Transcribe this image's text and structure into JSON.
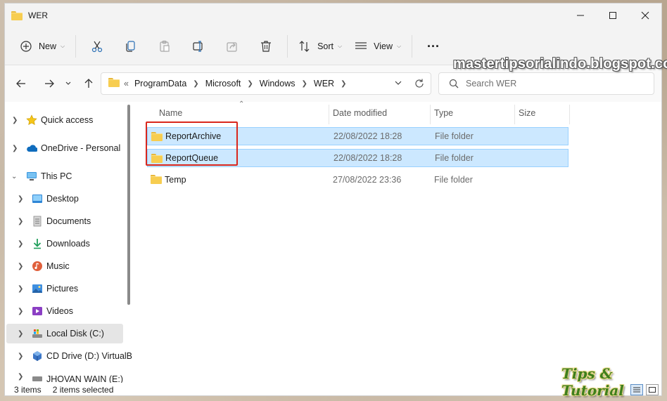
{
  "window": {
    "title": "WER"
  },
  "toolbar": {
    "new_label": "New",
    "sort_label": "Sort",
    "view_label": "View",
    "more_label": "..."
  },
  "address": {
    "overflow": "«",
    "crumbs": [
      "ProgramData",
      "Microsoft",
      "Windows",
      "WER"
    ]
  },
  "search": {
    "placeholder": "Search WER"
  },
  "nav": {
    "items": [
      {
        "label": "Quick access",
        "icon": "star-icon"
      },
      {
        "label": "OneDrive - Personal",
        "icon": "cloud-icon"
      },
      {
        "label": "This PC",
        "icon": "computer-icon"
      },
      {
        "label": "Desktop",
        "icon": "desktop-icon"
      },
      {
        "label": "Documents",
        "icon": "document-icon"
      },
      {
        "label": "Downloads",
        "icon": "download-icon"
      },
      {
        "label": "Music",
        "icon": "music-icon"
      },
      {
        "label": "Pictures",
        "icon": "pictures-icon"
      },
      {
        "label": "Videos",
        "icon": "video-icon"
      },
      {
        "label": "Local Disk (C:)",
        "icon": "drive-icon"
      },
      {
        "label": "CD Drive (D:) VirtualB",
        "icon": "cd-drive-icon"
      },
      {
        "label": "JHOVAN WAIN (E:)",
        "icon": "drive-icon"
      }
    ]
  },
  "columns": {
    "name": "Name",
    "date": "Date modified",
    "type": "Type",
    "size": "Size"
  },
  "files": [
    {
      "name": "ReportArchive",
      "date": "22/08/2022 18:28",
      "type": "File folder",
      "selected": true
    },
    {
      "name": "ReportQueue",
      "date": "22/08/2022 18:28",
      "type": "File folder",
      "selected": true
    },
    {
      "name": "Temp",
      "date": "27/08/2022 23:36",
      "type": "File folder",
      "selected": false
    }
  ],
  "status": {
    "item_count": "3 items",
    "selected_count": "2 items selected"
  },
  "watermarks": {
    "blog": "mastertipsorialindo.blogspot.com",
    "tips": "Tips & Tutorial"
  },
  "colors": {
    "selection_bg": "#cce8ff",
    "selection_border": "#99d1ff",
    "highlight_box": "#d9261c",
    "folder": "#f7cd50"
  }
}
